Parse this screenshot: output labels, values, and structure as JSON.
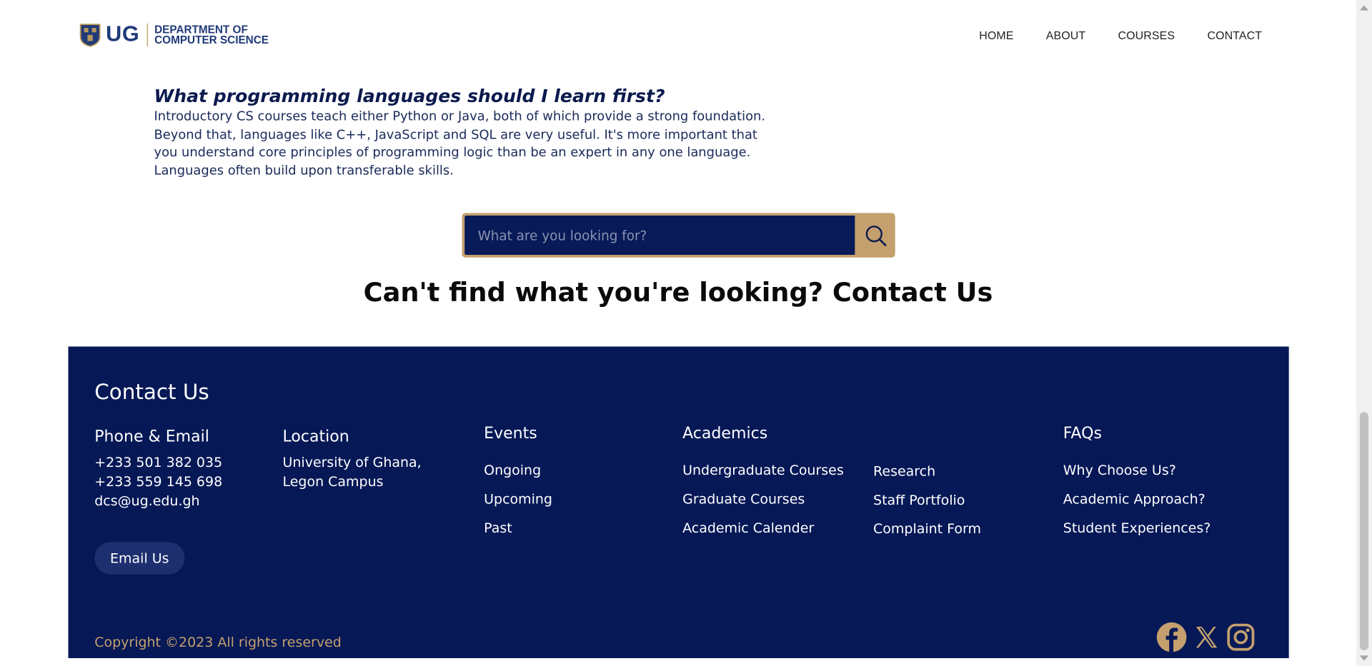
{
  "header": {
    "logo_ug": "UG",
    "logo_dept_line1": "DEPARTMENT OF",
    "logo_dept_line2": "COMPUTER SCIENCE",
    "nav": [
      "HOME",
      "ABOUT",
      "COURSES",
      "CONTACT"
    ]
  },
  "faq": {
    "question": "What programming languages should I learn first?",
    "answer": "Introductory CS courses teach either Python or Java, both of which provide a strong foundation. Beyond that, languages like C++, JavaScript and SQL are very useful. It's more important that you understand core principles of programming logic than be an expert in any one language. Languages often build upon transferable skills."
  },
  "search": {
    "placeholder": "What are you looking for?",
    "icon": "search-icon"
  },
  "cta": "Can't find what you're looking? Contact Us",
  "footer": {
    "title": "Contact Us",
    "phone_email": {
      "heading": "Phone & Email",
      "phone1": "+233 501 382 035",
      "phone2": "+233 559 145 698",
      "email": "dcs@ug.edu.gh"
    },
    "location": {
      "heading": "Location",
      "line1": "University of Ghana,",
      "line2": "Legon Campus"
    },
    "events": {
      "heading": "Events",
      "links": [
        "Ongoing",
        "Upcoming",
        "Past"
      ]
    },
    "academics": {
      "heading": "Academics",
      "links_col1": [
        "Undergraduate Courses",
        "Graduate Courses",
        "Academic Calender"
      ],
      "links_col2": [
        "Research",
        "Staff Portfolio",
        "Complaint Form"
      ]
    },
    "faqs": {
      "heading": "FAQs",
      "links": [
        "Why Choose Us?",
        "Academic Approach?",
        "Student Experiences?"
      ]
    },
    "email_button": "Email Us",
    "copyright": "Copyright ©2023 All rights reserved",
    "social_icons": [
      "facebook-icon",
      "x-icon",
      "instagram-icon"
    ]
  },
  "colors": {
    "navy": "#061856",
    "gold": "#c4a06e",
    "search_bg": "#081a57"
  }
}
